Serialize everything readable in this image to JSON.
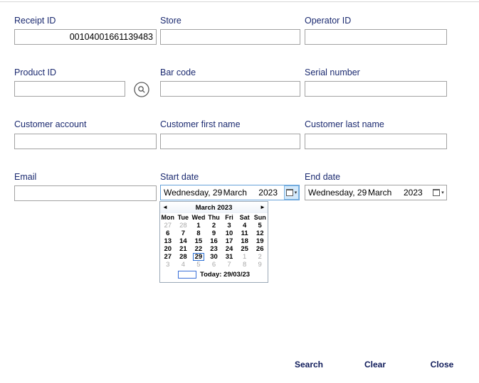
{
  "form": {
    "fields": [
      {
        "label": "Receipt ID",
        "value": "00104001661139483"
      },
      {
        "label": "Store",
        "value": ""
      },
      {
        "label": "Operator ID",
        "value": ""
      },
      {
        "label": "Product ID",
        "value": ""
      },
      {
        "label": "Bar code",
        "value": ""
      },
      {
        "label": "Serial number",
        "value": ""
      },
      {
        "label": "Customer account",
        "value": ""
      },
      {
        "label": "Customer first name",
        "value": ""
      },
      {
        "label": "Customer last name",
        "value": ""
      },
      {
        "label": "Email",
        "value": ""
      }
    ],
    "start_date": {
      "label": "Start date",
      "day_text": "Wednesday, 29",
      "month_text": "March",
      "year_text": "2023"
    },
    "end_date": {
      "label": "End date",
      "day_text": "Wednesday, 29",
      "month_text": "March",
      "year_text": "2023"
    },
    "actions": [
      {
        "label": "Search"
      },
      {
        "label": "Clear"
      },
      {
        "label": "Close"
      }
    ]
  },
  "icons": {
    "prev": "◄",
    "next": "►",
    "dropdown_arrow": "▾"
  },
  "calendar": {
    "month_title": "March 2023",
    "day_headers": [
      "Mon",
      "Tue",
      "Wed",
      "Thu",
      "Fri",
      "Sat",
      "Sun"
    ],
    "weeks": [
      [
        {
          "d": "27",
          "muted": true
        },
        {
          "d": "28",
          "muted": true
        },
        {
          "d": "1"
        },
        {
          "d": "2"
        },
        {
          "d": "3"
        },
        {
          "d": "4"
        },
        {
          "d": "5"
        }
      ],
      [
        {
          "d": "6"
        },
        {
          "d": "7"
        },
        {
          "d": "8"
        },
        {
          "d": "9"
        },
        {
          "d": "10"
        },
        {
          "d": "11"
        },
        {
          "d": "12"
        }
      ],
      [
        {
          "d": "13"
        },
        {
          "d": "14"
        },
        {
          "d": "15"
        },
        {
          "d": "16"
        },
        {
          "d": "17"
        },
        {
          "d": "18"
        },
        {
          "d": "19"
        }
      ],
      [
        {
          "d": "20"
        },
        {
          "d": "21"
        },
        {
          "d": "22"
        },
        {
          "d": "23"
        },
        {
          "d": "24"
        },
        {
          "d": "25"
        },
        {
          "d": "26"
        }
      ],
      [
        {
          "d": "27"
        },
        {
          "d": "28"
        },
        {
          "d": "29",
          "selected": true
        },
        {
          "d": "30"
        },
        {
          "d": "31"
        },
        {
          "d": "1",
          "muted": true
        },
        {
          "d": "2",
          "muted": true
        }
      ],
      [
        {
          "d": "3",
          "muted": true
        },
        {
          "d": "4",
          "muted": true
        },
        {
          "d": "5",
          "muted": true
        },
        {
          "d": "6",
          "muted": true
        },
        {
          "d": "7",
          "muted": true
        },
        {
          "d": "8",
          "muted": true
        },
        {
          "d": "9",
          "muted": true
        }
      ]
    ],
    "selected_day": "29",
    "today_label": "Today: 29/03/23"
  },
  "colors": {
    "label_text": "#1b2a70",
    "action_text": "#0f1b5a",
    "field_border": "#a2a2a2",
    "focus_border": "#66a1d8",
    "focus_fill": "#d3e9fb",
    "selected_day_outline": "#2a6fd4",
    "muted_day": "#a8a8a8"
  }
}
